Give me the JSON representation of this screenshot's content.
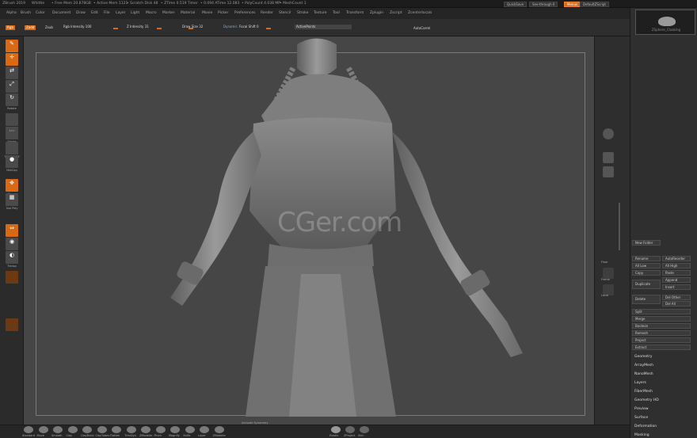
{
  "titlebar": {
    "app": "ZBrush 2019",
    "file": "Whittle",
    "stats": [
      "• Free Mem 20.878GB",
      "• Active Mem 1121",
      "• Scratch Disk 48",
      "• ZTime 0.519 Timer",
      "• 0.094 ATime 12.083",
      "• PolyCount 4.038 MP",
      "• MeshCount 1"
    ],
    "quicksave": "QuickSave",
    "transparent": "See-through 0",
    "menus_btn": "Menus",
    "defaultscript": "DefaultZScript"
  },
  "menubar": {
    "items": [
      "Alpha",
      "Brush",
      "Color",
      "Document",
      "Draw",
      "Edit",
      "File",
      "Layer",
      "Light",
      "Macro",
      "Marker",
      "Material",
      "Movie",
      "Picker",
      "Preferences",
      "Render",
      "Stencil",
      "Stroke",
      "Texture",
      "Tool",
      "Transform",
      "Zplugin",
      "Zscript",
      "Zcenterlocals"
    ]
  },
  "toolbar": {
    "gozfile": "READING GOZ FILE...",
    "rgb": "Rgb",
    "zadd": "Zadd",
    "zsub": "Zsub",
    "rgb_intensity": "Rgb Intensity 100",
    "z_intensity": "Z Intensity 31",
    "draw_size": "Draw Size 32",
    "dynamic": "Dynamic",
    "focal_shift": "Focal Shift 0",
    "activepoints": "ActivePoints",
    "autocorrel": "AutoCorrel"
  },
  "lefttray": {
    "tools": [
      {
        "label": "Edit",
        "glyph": "✎",
        "style": "orange"
      },
      {
        "label": "Draw",
        "glyph": "✛",
        "style": "orange"
      },
      {
        "label": "Move",
        "glyph": "⇄",
        "style": "grey"
      },
      {
        "label": "Scale",
        "glyph": "⤢",
        "style": "grey"
      },
      {
        "label": "Rotate",
        "glyph": "↻",
        "style": "grey"
      },
      {
        "label": "Alpha Off",
        "glyph": "",
        "style": "grey"
      },
      {
        "label": "Stroke",
        "glyph": "⋯",
        "style": "grey"
      },
      {
        "label": "Texture Off",
        "glyph": "",
        "style": "grey"
      },
      {
        "label": "MatCap",
        "glyph": "●",
        "style": "grey"
      },
      {
        "label": "Gizmo",
        "glyph": "✥",
        "style": "orange"
      },
      {
        "label": "Use Poly",
        "glyph": "▦",
        "style": "grey"
      },
      {
        "label": "L.Sym",
        "glyph": "⇔",
        "style": "orange"
      },
      {
        "label": "Solo",
        "glyph": "◉",
        "style": "grey"
      },
      {
        "label": "Transp",
        "glyph": "◐",
        "style": "grey"
      },
      {
        "label": "",
        "glyph": "",
        "style": "dim"
      },
      {
        "label": "",
        "glyph": "",
        "style": "dim"
      }
    ]
  },
  "viewport": {
    "watermark": "CGer.com"
  },
  "righttray": {
    "floor": "Floor",
    "frame": "Frame",
    "xyz": "Local",
    "polyf": "PolyF"
  },
  "subtool": {
    "thumb_label": "ZSphere_Cloaking",
    "new_folder": "New Folder",
    "buttons_left": [
      "Rename",
      "All Low",
      "Copy",
      "Duplicate",
      "Delete",
      "Split",
      "Merge",
      "Boolean",
      "Remesh",
      "Project",
      "Extract"
    ],
    "buttons_right": [
      "AutoReorder",
      "All High",
      "Paste",
      "Append",
      "Insert",
      "Del Other",
      "Del All"
    ]
  },
  "palettes": {
    "items": [
      "Geometry",
      "ArrayMesh",
      "NanoMesh",
      "Layers",
      "FiberMesh",
      "Geometry HD",
      "Preview",
      "Surface",
      "Deformation",
      "Masking"
    ]
  },
  "bottombar": {
    "brushes": [
      "Standard",
      "Move",
      "Smooth",
      "Clay",
      "ClayBuild",
      "ClayTubes",
      "Flatten",
      "TrimDyn",
      "ZModeler",
      "Pinch",
      "Magnify",
      "Knife",
      "Layer",
      "ZModeler"
    ],
    "symmetry": "Activate Symmetry",
    "materials": [
      "Elastic",
      "ZProject",
      "Skin"
    ]
  },
  "colors": {
    "accent": "#d86a15",
    "viewport_bg": "#464646",
    "panel_bg": "#2f2f2f"
  }
}
